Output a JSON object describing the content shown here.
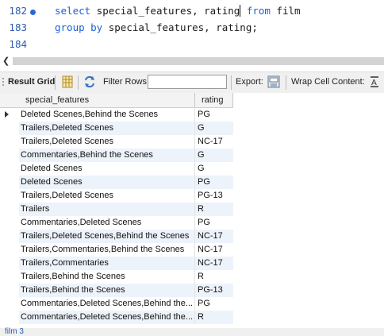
{
  "editor": {
    "lines": [
      {
        "num": "182",
        "has_dot": true,
        "kw1": "select",
        "mid": " special_features, rating",
        "kw2": "from",
        "tail": " film"
      },
      {
        "num": "183",
        "has_dot": false,
        "kw1": "group by",
        "mid": " special_features, rating;",
        "kw2": "",
        "tail": ""
      },
      {
        "num": "184",
        "has_dot": false,
        "kw1": "",
        "mid": "",
        "kw2": "",
        "tail": ""
      }
    ]
  },
  "toolbar": {
    "result_grid_label": "Result Grid",
    "filter_rows_label": "Filter Rows:",
    "filter_value": "",
    "export_label": "Export:",
    "wrap_label": "Wrap Cell Content:"
  },
  "grid": {
    "headers": [
      "special_features",
      "rating"
    ],
    "rows": [
      {
        "special_features": "Deleted Scenes,Behind the Scenes",
        "rating": "PG"
      },
      {
        "special_features": "Trailers,Deleted Scenes",
        "rating": "G"
      },
      {
        "special_features": "Trailers,Deleted Scenes",
        "rating": "NC-17"
      },
      {
        "special_features": "Commentaries,Behind the Scenes",
        "rating": "G"
      },
      {
        "special_features": "Deleted Scenes",
        "rating": "G"
      },
      {
        "special_features": "Deleted Scenes",
        "rating": "PG"
      },
      {
        "special_features": "Trailers,Deleted Scenes",
        "rating": "PG-13"
      },
      {
        "special_features": "Trailers",
        "rating": "R"
      },
      {
        "special_features": "Commentaries,Deleted Scenes",
        "rating": "PG"
      },
      {
        "special_features": "Trailers,Deleted Scenes,Behind the Scenes",
        "rating": "NC-17"
      },
      {
        "special_features": "Trailers,Commentaries,Behind the Scenes",
        "rating": "NC-17"
      },
      {
        "special_features": "Trailers,Commentaries",
        "rating": "NC-17"
      },
      {
        "special_features": "Trailers,Behind the Scenes",
        "rating": "R"
      },
      {
        "special_features": "Trailers,Behind the Scenes",
        "rating": "PG-13"
      },
      {
        "special_features": "Commentaries,Deleted Scenes,Behind the...",
        "rating": "PG"
      },
      {
        "special_features": "Commentaries,Deleted Scenes,Behind the...",
        "rating": "R"
      }
    ]
  },
  "bottom_tab": {
    "label": "film 3"
  },
  "colors": {
    "keyword": "#1c5fd6",
    "line_number": "#2a5db0",
    "alt_row": "#edf3fb"
  },
  "icons": [
    "grid-icon",
    "refresh-icon",
    "export-icon",
    "wrap-icon",
    "scroll-left-icon"
  ]
}
